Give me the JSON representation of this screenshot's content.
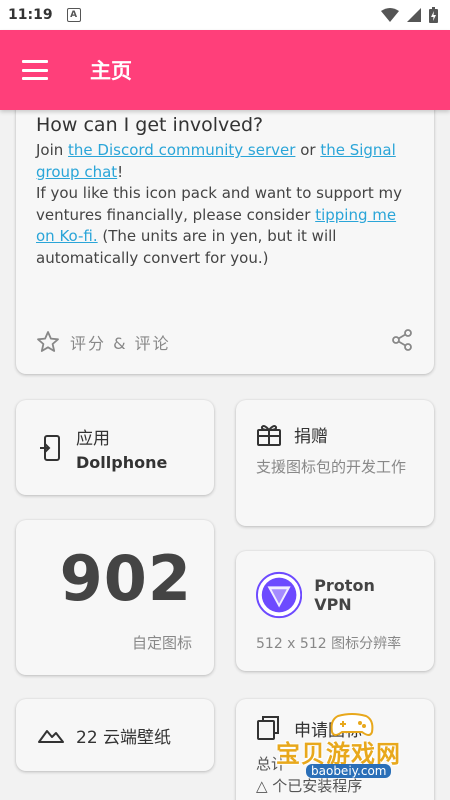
{
  "status_bar": {
    "time": "11:19",
    "notification_icon": "a-icon"
  },
  "app_bar": {
    "title": "主页",
    "menu_icon": "menu-icon"
  },
  "info_card": {
    "heading": "How can I get involved?",
    "p1_before": "Join ",
    "p1_link1": "the Discord community server",
    "p1_mid": " or ",
    "p1_link2": "the Signal group chat",
    "p1_after": "!",
    "p2_before": "If you like this icon pack and want to support my ventures financially, please consider ",
    "p2_link": "tipping me on Ko-fi.",
    "p2_after": " (The units are in yen, but it will automatically convert for you.)",
    "rate_label": "评分 & 评论"
  },
  "app_card": {
    "label": "应用",
    "value": "Dollphone"
  },
  "donate_card": {
    "title": "捐赠",
    "description": "支援图标包的开发工作"
  },
  "count_card": {
    "count": "902",
    "label": "自定图标"
  },
  "vpn_card": {
    "name": "Proton VPN",
    "description": "512 x 512 图标分辨率"
  },
  "wallpaper_card": {
    "label": "22 云端壁纸"
  },
  "request_card": {
    "title": "申请图标",
    "line1": "总计",
    "line2": "△ 个已安装程序"
  },
  "watermark": {
    "text": "宝贝游戏网",
    "url": "baobeiy.com"
  },
  "colors": {
    "accent": "#ff3f7a",
    "link": "#2aa5d8",
    "vpn": "#6d4aff"
  }
}
